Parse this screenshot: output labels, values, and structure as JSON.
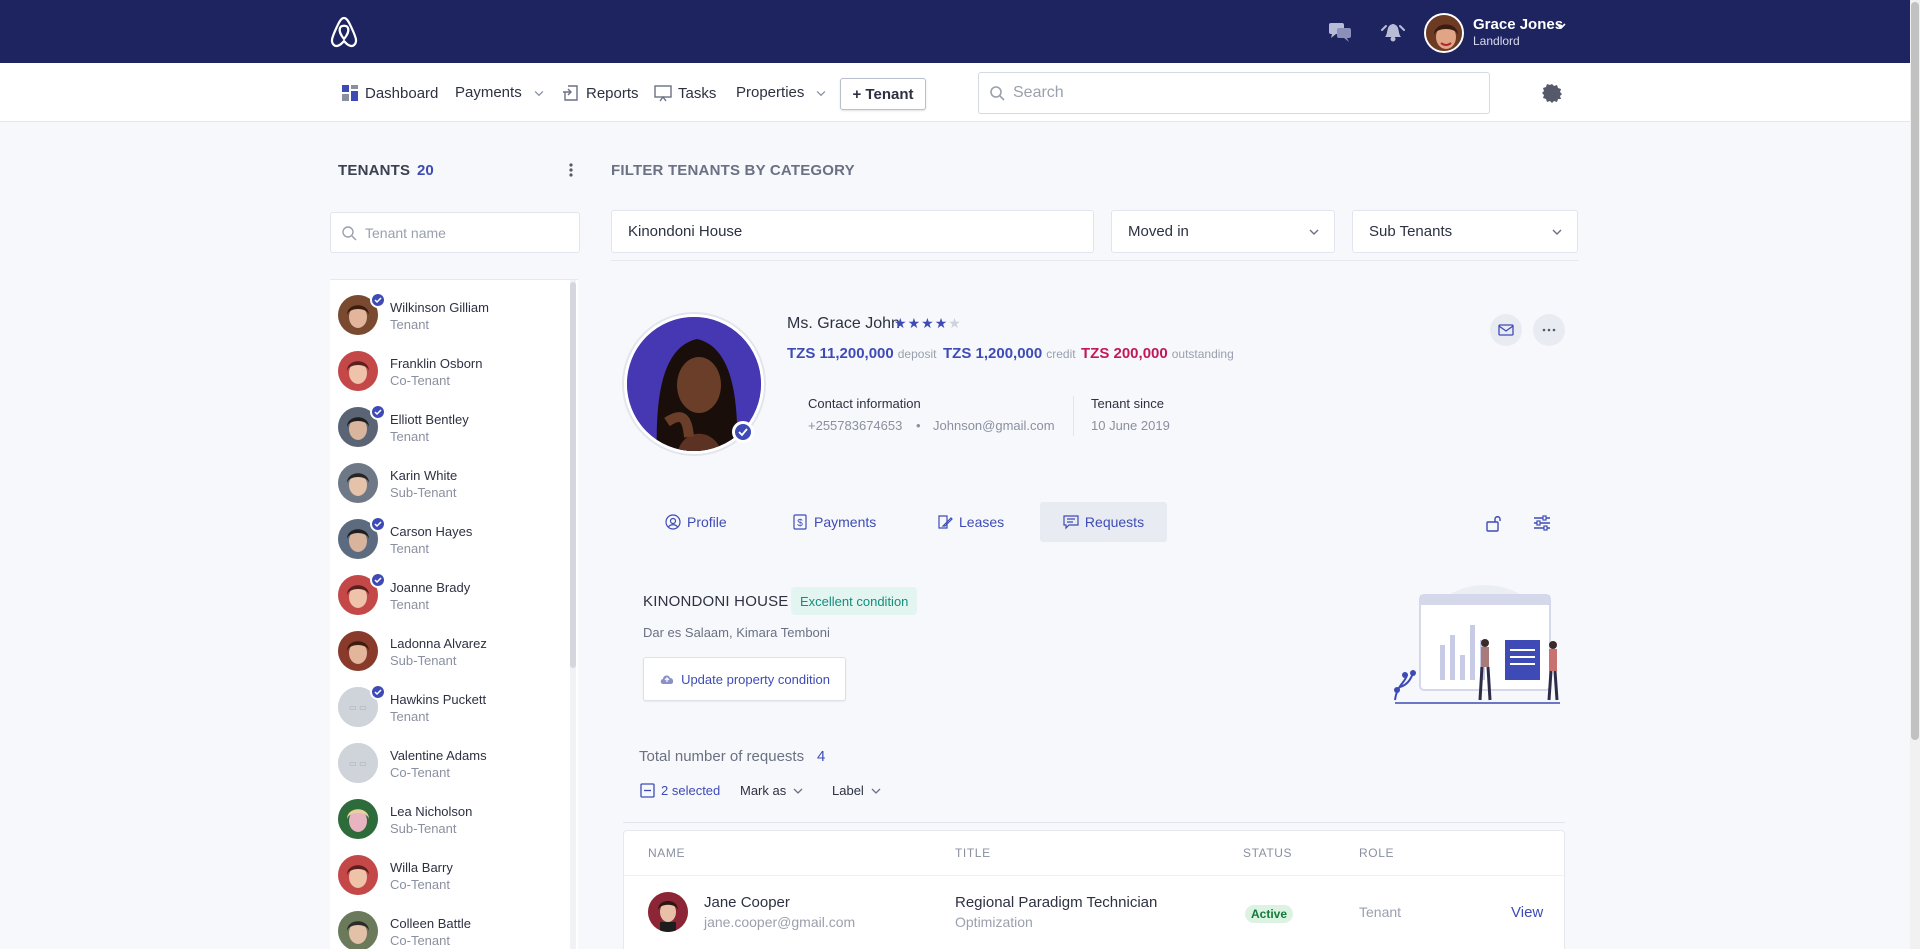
{
  "topbar": {
    "user_name": "Grace Jones",
    "user_role": "Landlord"
  },
  "nav": {
    "dashboard": "Dashboard",
    "payments": "Payments",
    "reports": "Reports",
    "tasks": "Tasks",
    "properties": "Properties",
    "tenant_button": "+ Tenant",
    "search_placeholder": "Search"
  },
  "sidebar": {
    "title": "TENANTS",
    "count": "20",
    "search_placeholder": "Tenant name",
    "tenants": [
      {
        "name": "Wilkinson Gilliam",
        "role": "Tenant",
        "verified": true
      },
      {
        "name": "Franklin Osborn",
        "role": "Co-Tenant",
        "verified": false
      },
      {
        "name": "Elliott Bentley",
        "role": "Tenant",
        "verified": true
      },
      {
        "name": "Karin White",
        "role": "Sub-Tenant",
        "verified": false
      },
      {
        "name": "Carson Hayes",
        "role": "Tenant",
        "verified": true
      },
      {
        "name": "Joanne Brady",
        "role": "Tenant",
        "verified": true
      },
      {
        "name": "Ladonna Alvarez",
        "role": "Sub-Tenant",
        "verified": false
      },
      {
        "name": "Hawkins Puckett",
        "role": "Tenant",
        "verified": true
      },
      {
        "name": "Valentine Adams",
        "role": "Co-Tenant",
        "verified": false
      },
      {
        "name": "Lea Nicholson",
        "role": "Sub-Tenant",
        "verified": false
      },
      {
        "name": "Willa Barry",
        "role": "Co-Tenant",
        "verified": false
      },
      {
        "name": "Colleen Battle",
        "role": "Co-Tenant",
        "verified": false
      }
    ]
  },
  "filters": {
    "label": "FILTER TENANTS BY CATEGORY",
    "property": "Kinondoni House",
    "status": "Moved in",
    "type": "Sub Tenants"
  },
  "profile": {
    "name": "Ms. Grace John",
    "rating": 4,
    "deposit_amount": "TZS 11,200,000",
    "deposit_label": "deposit",
    "credit_amount": "TZS 1,200,000",
    "credit_label": "credit",
    "outstanding_amount": "TZS 200,000",
    "outstanding_label": "outstanding",
    "contact_heading": "Contact information",
    "phone": "+255783674653",
    "email": "Johnson@gmail.com",
    "since_heading": "Tenant since",
    "since_date": "10 June 2019"
  },
  "tabs": [
    {
      "label": "Profile",
      "icon": "user-circle-icon"
    },
    {
      "label": "Payments",
      "icon": "dollar-doc-icon"
    },
    {
      "label": "Leases",
      "icon": "doc-edit-icon"
    },
    {
      "label": "Requests",
      "icon": "chat-icon",
      "active": true
    }
  ],
  "property": {
    "name": "KINONDONI HOUSE",
    "condition": "Excellent condition",
    "address": "Dar es Salaam, Kimara Temboni",
    "update_button": "Update property condition"
  },
  "requests": {
    "total_label": "Total number of requests",
    "total": "4",
    "selected": "2 selected",
    "mark_as": "Mark as",
    "label": "Label",
    "columns": [
      "NAME",
      "TITLE",
      "STATUS",
      "ROLE"
    ],
    "rows": [
      {
        "name": "Jane Cooper",
        "email": "jane.cooper@gmail.com",
        "title": "Regional Paradigm Technician",
        "subtitle": "Optimization",
        "status": "Active",
        "role": "Tenant",
        "action": "View"
      }
    ]
  },
  "colors": {
    "brand": "#1e2460",
    "accent": "#3e4bb6",
    "outstanding": "#c2185b",
    "success": "#168d7a"
  }
}
